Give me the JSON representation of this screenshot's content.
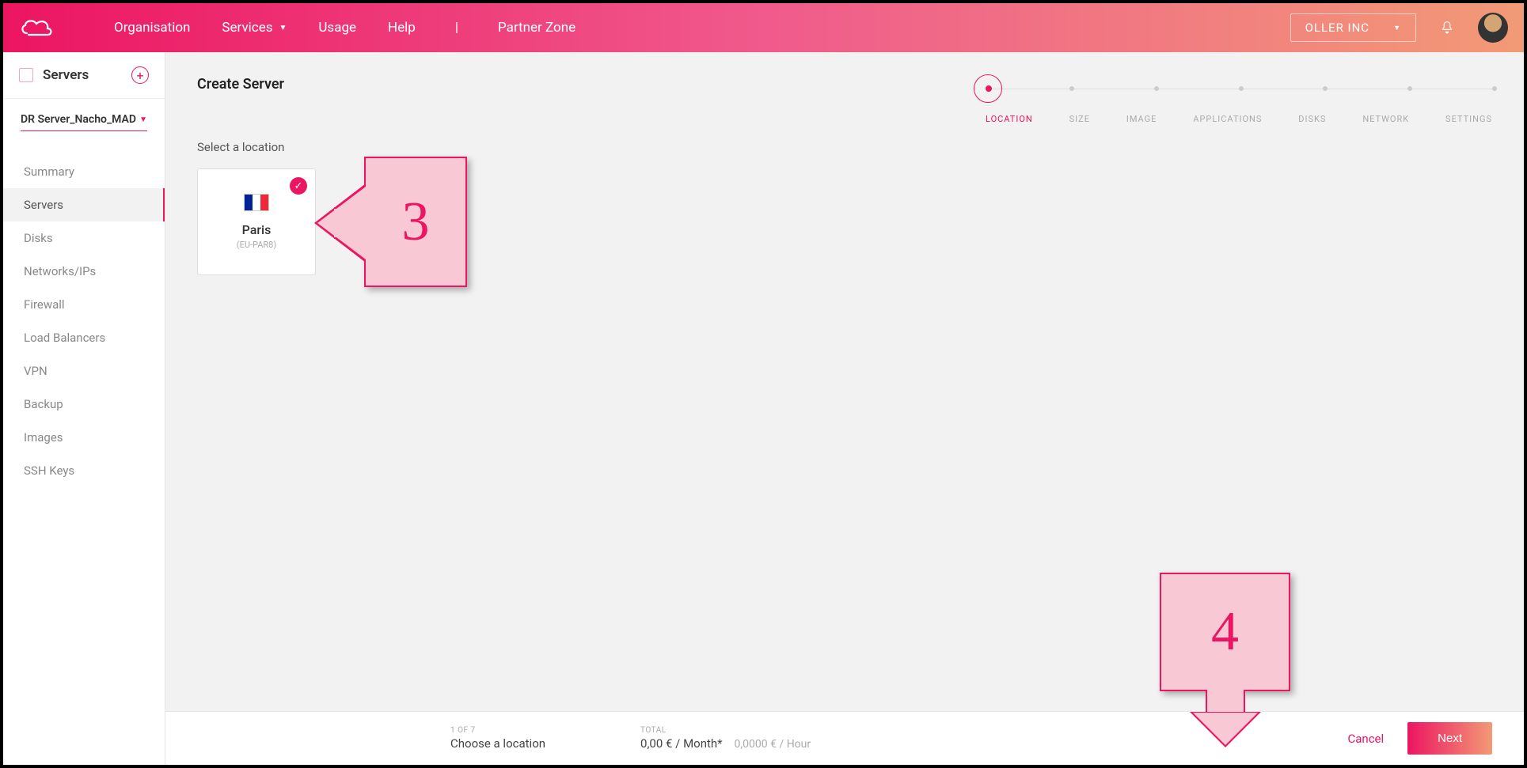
{
  "topnav": {
    "items": [
      "Organisation",
      "Services",
      "Usage",
      "Help"
    ],
    "partner": "Partner Zone",
    "org": "OLLER INC"
  },
  "sidebar": {
    "title": "Servers",
    "selected_server": "DR Server_Nacho_MAD",
    "menu": [
      "Summary",
      "Servers",
      "Disks",
      "Networks/IPs",
      "Firewall",
      "Load Balancers",
      "VPN",
      "Backup",
      "Images",
      "SSH Keys"
    ],
    "active_index": 1
  },
  "page": {
    "title": "Create Server",
    "section_label": "Select a location"
  },
  "location": {
    "name": "Paris",
    "code": "(EU-PAR8)"
  },
  "steps": [
    "LOCATION",
    "SIZE",
    "IMAGE",
    "APPLICATIONS",
    "DISKS",
    "NETWORK",
    "SETTINGS"
  ],
  "footer": {
    "step_label": "1 OF 7",
    "step_text": "Choose a location",
    "total_label": "TOTAL",
    "price_month": "0,00 € / Month*",
    "price_hour": "0,0000 € / Hour",
    "cancel": "Cancel",
    "next": "Next"
  },
  "callouts": {
    "c3": "3",
    "c4": "4"
  }
}
